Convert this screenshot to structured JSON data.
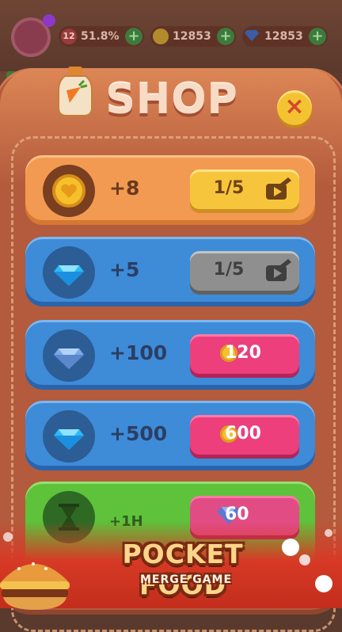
{
  "hud": {
    "level": "12",
    "progress": "51.8%",
    "coins": "12853",
    "gems": "12853",
    "plus": "+",
    "cash_icon": "$"
  },
  "shop": {
    "title": "SHOP",
    "close_label": "×",
    "offers": [
      {
        "reward_icon": "heart-coin-icon",
        "amount": "+8",
        "price": "1/5",
        "price_type": "ad",
        "state": "available"
      },
      {
        "reward_icon": "diamond-icon",
        "amount": "+5",
        "price": "1/5",
        "price_type": "ad",
        "state": "disabled"
      },
      {
        "reward_icon": "diamond-icon",
        "amount": "+100",
        "price": "120",
        "price_type": "coin"
      },
      {
        "reward_icon": "diamond-icon",
        "amount": "+500",
        "price": "600",
        "price_type": "coin"
      },
      {
        "reward_icon": "hourglass-icon",
        "amount": "+1H",
        "price": "60",
        "price_type": "gem"
      }
    ]
  },
  "logo": {
    "line1": "POCKET FOOD",
    "line2": "MERGE GAME"
  },
  "colors": {
    "panel": "#b35b3c",
    "orange_card": "#f39a52",
    "blue_card": "#3e8bd8",
    "green_card": "#5ec23b",
    "yellow_button": "#f7c53b",
    "pink_button": "#ec3f7c",
    "disabled_button": "#8f8f8f"
  }
}
